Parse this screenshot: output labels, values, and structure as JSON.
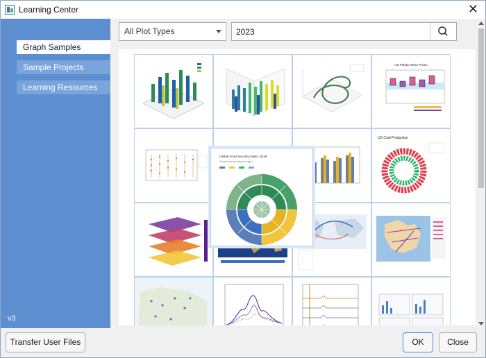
{
  "window": {
    "title": "Learning Center",
    "close_glyph": "✕",
    "icon": "app-icon"
  },
  "sidebar": {
    "items": [
      {
        "label": "Graph Samples",
        "active": true
      },
      {
        "label": "Sample Projects",
        "active": false
      },
      {
        "label": "Learning Resources",
        "active": false
      }
    ],
    "version": "v3"
  },
  "filter": {
    "plot_type": "All Plot Types",
    "search_value": "2023",
    "search_icon": "search-icon"
  },
  "gallery": {
    "thumbnails": [
      {
        "name": "thumb-3d-bars",
        "text": ""
      },
      {
        "name": "thumb-3d-wall-bars",
        "text": ""
      },
      {
        "name": "thumb-3d-helix",
        "text": ""
      },
      {
        "name": "thumb-box-plot",
        "text": "US Plastic Resin Prices"
      },
      {
        "name": "thumb-dot-plot",
        "text": ""
      },
      {
        "name": "thumb-sunburst",
        "text": ""
      },
      {
        "name": "thumb-grouped-bars",
        "text": ""
      },
      {
        "name": "thumb-coal-production",
        "text": "US Coal Production"
      },
      {
        "name": "thumb-3d-stacked-planes",
        "text": ""
      },
      {
        "name": "thumb-world-map",
        "text": ""
      },
      {
        "name": "thumb-flow-map",
        "text": ""
      },
      {
        "name": "thumb-europe-map",
        "text": ""
      },
      {
        "name": "thumb-city-map",
        "text": ""
      },
      {
        "name": "thumb-spectrum-peaks",
        "text": ""
      },
      {
        "name": "thumb-stacked-spectra",
        "text": ""
      },
      {
        "name": "thumb-panel-plots",
        "text": ""
      }
    ],
    "hover_card": {
      "title": "Global Food Security Index, 2019",
      "subtitle": "Global food security by region"
    }
  },
  "colors": {
    "sidebar": "#5d8fd0",
    "nav_inactive": "#7aa5dc",
    "thumb_border": "#b9d1ee",
    "ok_border": "#4a8ad6"
  },
  "buttons": {
    "transfer": "Transfer User Files",
    "ok": "OK",
    "close": "Close"
  }
}
